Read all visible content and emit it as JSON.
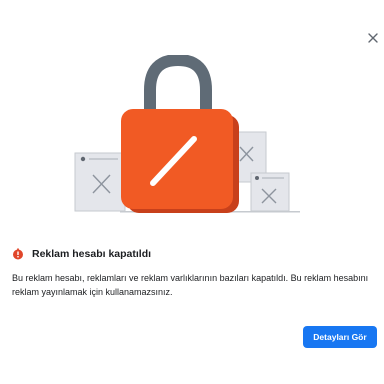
{
  "dialog": {
    "title": "Reklam hesabı kapatıldı",
    "body": "Bu reklam hesabı, reklamları ve reklam varlıklarının bazıları kapatıldı. Bu reklam hesabını reklam yayınlamak için kullanamazsınız.",
    "details_button_label": "Detayları Gör"
  },
  "colors": {
    "accent": "#1877f2",
    "lock_body": "#f15a24",
    "lock_shackle": "#5f6b76",
    "warning": "#e0462a"
  },
  "icons": {
    "close": "close-icon",
    "warning": "warning-icon",
    "illustration": "lock-illustration"
  }
}
